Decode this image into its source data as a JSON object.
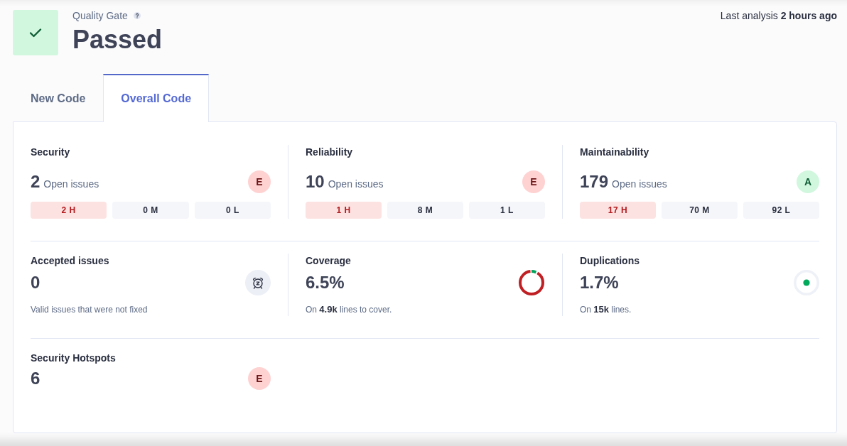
{
  "quality_gate": {
    "label": "Quality Gate",
    "status": "Passed",
    "passed": true
  },
  "last_analysis": "Last analysis **2 hours ago**",
  "tabs": [
    {
      "label": "New Code",
      "selected": false
    },
    {
      "label": "Overall Code",
      "selected": true
    }
  ],
  "rows": [
    [
      {
        "kind": "issues",
        "title": "Security",
        "value": "2",
        "value_label": "Open issues",
        "rating": "E",
        "severities": [
          {
            "label": "2 H",
            "alert": true
          },
          {
            "label": "0 M",
            "alert": false
          },
          {
            "label": "0 L",
            "alert": false
          }
        ]
      },
      {
        "kind": "issues",
        "title": "Reliability",
        "value": "10",
        "value_label": "Open issues",
        "rating": "E",
        "severities": [
          {
            "label": "1 H",
            "alert": true
          },
          {
            "label": "8 M",
            "alert": false
          },
          {
            "label": "1 L",
            "alert": false
          }
        ]
      },
      {
        "kind": "issues",
        "title": "Maintainability",
        "value": "179",
        "value_label": "Open issues",
        "rating": "A",
        "severities": [
          {
            "label": "17 H",
            "alert": true
          },
          {
            "label": "70 M",
            "alert": false
          },
          {
            "label": "92 L",
            "alert": false
          }
        ]
      }
    ],
    [
      {
        "kind": "accepted",
        "title": "Accepted issues",
        "value": "0",
        "note": "Valid issues that were not fixed"
      },
      {
        "kind": "coverage",
        "title": "Coverage",
        "value": "6.5%",
        "level": 0.065,
        "note": "On **4.9k** lines to cover."
      },
      {
        "kind": "duplications",
        "title": "Duplications",
        "value": "1.7%",
        "note": "On **15k** lines."
      }
    ],
    [
      {
        "kind": "hotspots",
        "title": "Security Hotspots",
        "value": "6",
        "rating": "E"
      }
    ]
  ]
}
